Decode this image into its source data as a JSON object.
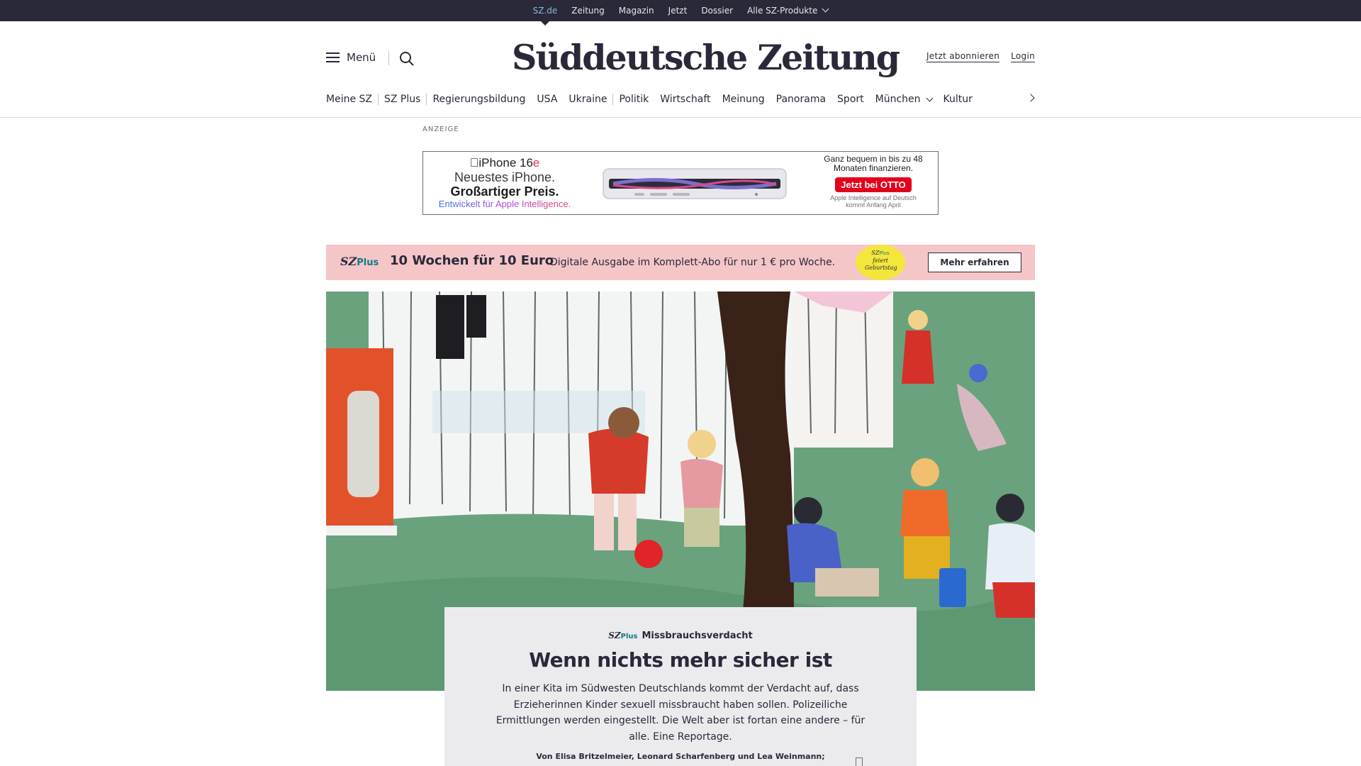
{
  "topbar": {
    "items": [
      "SZ.de",
      "Zeitung",
      "Magazin",
      "Jetzt",
      "Dossier",
      "Alle SZ-Produkte"
    ],
    "active": "SZ.de"
  },
  "header": {
    "menu_label": "Menü",
    "logo_text": "Süddeutsche Zeitung",
    "subscribe_label": "Jetzt abonnieren",
    "login_label": "Login"
  },
  "nav": {
    "items": [
      "Meine SZ",
      "SZ Plus",
      "Regierungsbildung",
      "USA",
      "Ukraine",
      "Politik",
      "Wirtschaft",
      "Meinung",
      "Panorama",
      "Sport",
      "München",
      "Kultur"
    ]
  },
  "ad": {
    "label": "ANZEIGE",
    "product": "iPhone 16",
    "product_suffix": "e",
    "line1": "Neuestes iPhone.",
    "line2": "Großartiger Preis.",
    "line3": "Entwickelt für Apple Intelligence.",
    "right_line1": "Ganz bequem in bis zu 48 Monaten finanzieren.",
    "cta": "Jetzt bei OTTO",
    "right_line2": "Apple Intelligence auf Deutsch kommt Anfang April"
  },
  "promo": {
    "logo": "SZ",
    "logo_plus": "Plus",
    "title": "10 Wochen für 10 Euro",
    "text": "Digitale Ausgabe im Komplett-Abo für nur 1 € pro Woche.",
    "badge_top": "SZ",
    "badge_plus": "Plus",
    "badge_text": "feiert Geburtstag",
    "button": "Mehr erfahren",
    "colors": {
      "background": "#f5c6c8",
      "badge": "#f4e63a"
    }
  },
  "article": {
    "kicker_logo": "SZ",
    "kicker_plus": "Plus",
    "kicker": "Missbrauchsverdacht",
    "title": "Wenn nichts mehr sicher ist",
    "teaser": "In einer Kita im Südwesten Deutschlands kommt der Verdacht auf, dass Erzieherinnen Kinder sexuell missbraucht haben sollen. Polizeiliche Ermittlungen werden eingestellt. Die Welt aber ist fortan eine andere – für alle. Eine Reportage.",
    "byline": "Von Elisa Britzelmeier, Leonard Scharfenberg und Lea Weinmann;"
  },
  "colors": {
    "dark": "#29293a",
    "accent_plus": "#0f7a84",
    "otto_red": "#e3001b"
  }
}
